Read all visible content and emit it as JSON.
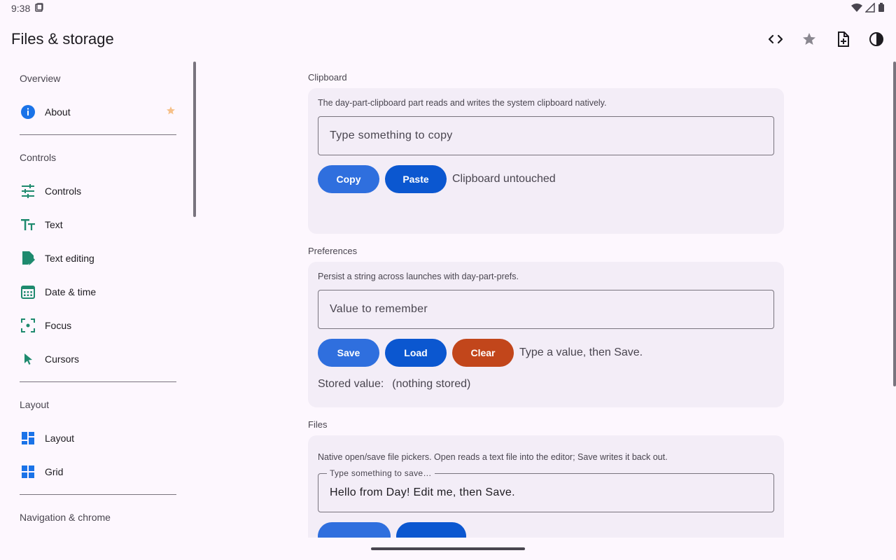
{
  "status_bar": {
    "time": "9:38"
  },
  "app_bar": {
    "title": "Files & storage"
  },
  "sidebar": {
    "sections": [
      {
        "header": "Overview",
        "items": [
          {
            "label": "About",
            "icon": "info-icon",
            "starred": true
          }
        ]
      },
      {
        "header": "Controls",
        "items": [
          {
            "label": "Controls",
            "icon": "tune-icon"
          },
          {
            "label": "Text",
            "icon": "text-fields-icon"
          },
          {
            "label": "Text editing",
            "icon": "edit-document-icon"
          },
          {
            "label": "Date & time",
            "icon": "calendar-icon"
          },
          {
            "label": "Focus",
            "icon": "focus-icon"
          },
          {
            "label": "Cursors",
            "icon": "cursor-icon"
          }
        ]
      },
      {
        "header": "Layout",
        "items": [
          {
            "label": "Layout",
            "icon": "dashboard-icon"
          },
          {
            "label": "Grid",
            "icon": "grid-icon"
          }
        ]
      },
      {
        "header": "Navigation & chrome",
        "items": []
      }
    ]
  },
  "clipboard": {
    "title": "Clipboard",
    "description": "The day-part-clipboard part reads and writes the system clipboard natively.",
    "input_placeholder": "Type something to copy",
    "copy_label": "Copy",
    "paste_label": "Paste",
    "status": "Clipboard untouched"
  },
  "preferences": {
    "title": "Preferences",
    "description": "Persist a string across launches with day-part-prefs.",
    "input_placeholder": "Value to remember",
    "save_label": "Save",
    "load_label": "Load",
    "clear_label": "Clear",
    "status": "Type a value, then Save.",
    "stored_label": "Stored value:",
    "stored_value": "(nothing stored)"
  },
  "files": {
    "title": "Files",
    "description": "Native open/save file pickers. Open reads a text file into the editor; Save writes it back out.",
    "input_label": "Type something to save…",
    "input_value": "Hello from Day! Edit me, then Save."
  },
  "colors": {
    "accent_blue": "#2f6fde",
    "accent_dark_blue": "#0b57d0",
    "danger": "#c2461b",
    "icon_teal": "#1e8a6e"
  }
}
